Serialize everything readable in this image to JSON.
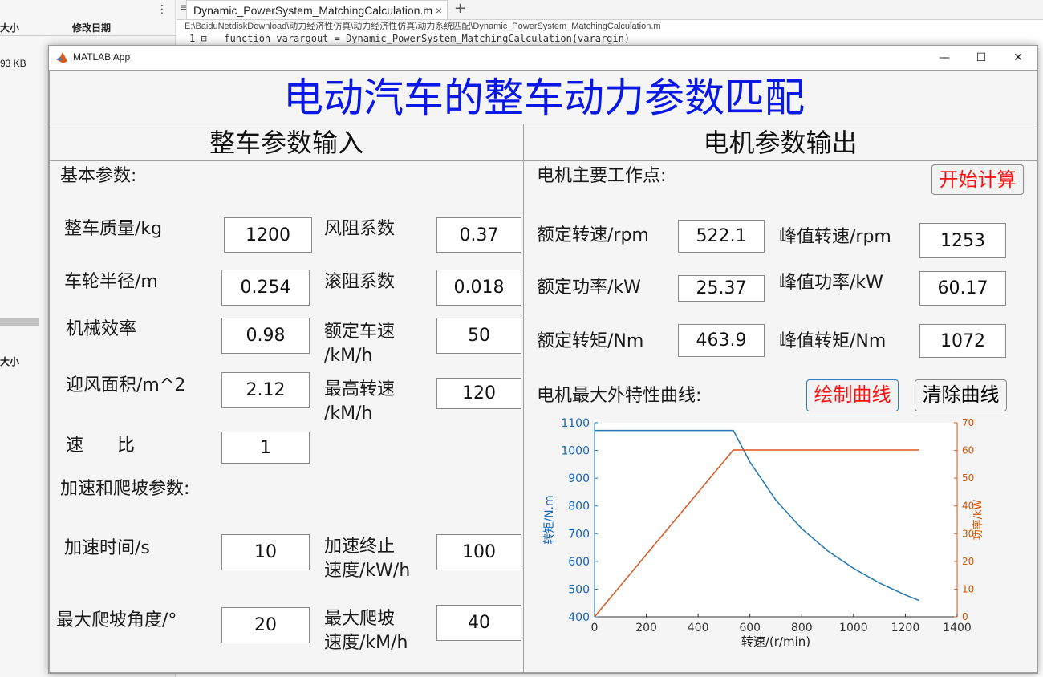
{
  "background": {
    "left_header_size": "大小",
    "left_header_date": "修改日期",
    "left_size_value": "93 KB",
    "left_section_size": "大小",
    "editor_tab": "Dynamic_PowerSystem_MatchingCalculation.m",
    "editor_tab_close": "×",
    "editor_new_tab": "+",
    "editor_path": "E:\\BaiduNetdiskDownload\\动力经济性仿真\\动力经济性仿真\\动力系统匹配\\Dynamic_PowerSystem_MatchingCalculation.m",
    "code_line": "1 ⊟   function varargout = Dynamic_PowerSystem_MatchingCalculation(varargin)"
  },
  "window": {
    "title": "MATLAB App",
    "minimize": "—",
    "maximize": "☐",
    "close": "✕"
  },
  "app": {
    "main_title": "电动汽车的整车动力参数匹配",
    "left_panel": {
      "title": "整车参数输入",
      "basic_params": "基本参数:",
      "accel_params": "加速和爬坡参数:",
      "fields": {
        "mass": {
          "label": "整车质量/kg",
          "value": "1200"
        },
        "drag": {
          "label": "风阻系数",
          "value": "0.37"
        },
        "wheel_radius": {
          "label": "车轮半径/m",
          "value": "0.254"
        },
        "rolling": {
          "label": "滚阻系数",
          "value": "0.018"
        },
        "mech_eff": {
          "label": "机械效率",
          "value": "0.98"
        },
        "rated_speed_l1": "额定车速",
        "rated_speed_l2": "/kM/h",
        "rated_speed_value": "50",
        "frontal_area": {
          "label": "迎风面积/m^2",
          "value": "2.12"
        },
        "max_speed_l1": "最高转速",
        "max_speed_l2": "/kM/h",
        "max_speed_value": "120",
        "ratio": {
          "label": "速      比",
          "value": "1"
        },
        "accel_time": {
          "label": "加速时间/s",
          "value": "10"
        },
        "accel_end_l1": "加速终止",
        "accel_end_l2": "速度/kW/h",
        "accel_end_value": "100",
        "max_grade": {
          "label": "最大爬坡角度/°",
          "value": "20"
        },
        "grade_speed_l1": "最大爬坡",
        "grade_speed_l2": "速度/kM/h",
        "grade_speed_value": "40"
      }
    },
    "right_panel": {
      "title": "电机参数输出",
      "main_points": "电机主要工作点:",
      "start_button": "开始计算",
      "outputs": {
        "rated_rpm": {
          "label": "额定转速/rpm",
          "value": "522.1"
        },
        "peak_rpm": {
          "label": "峰值转速/rpm",
          "value": "1253"
        },
        "rated_power": {
          "label": "额定功率/kW",
          "value": "25.37"
        },
        "peak_power": {
          "label": "峰值功率/kW",
          "value": "60.17"
        },
        "rated_torque": {
          "label": "额定转矩/Nm",
          "value": "463.9"
        },
        "peak_torque": {
          "label": "峰值转矩/Nm",
          "value": "1072"
        }
      },
      "curve_label": "电机最大外特性曲线:",
      "draw_button": "绘制曲线",
      "clear_button": "清除曲线"
    }
  },
  "chart_data": {
    "type": "line",
    "xlabel": "转速/(r/min)",
    "ylabel": "转矩/N.m",
    "ylabel_right": "功率/kW",
    "xlim": [
      0,
      1400
    ],
    "ylim": [
      400,
      1100
    ],
    "ylim_right": [
      0,
      70
    ],
    "xticks": [
      0,
      200,
      400,
      600,
      800,
      1000,
      1200,
      1400
    ],
    "yticks": [
      400,
      500,
      600,
      700,
      800,
      900,
      1000,
      1100
    ],
    "yticks_right": [
      0,
      10,
      20,
      30,
      40,
      50,
      60,
      70
    ],
    "grid": false,
    "colors": {
      "torque": "#1f77b4",
      "power": "#d95319"
    },
    "series": [
      {
        "axis": "left",
        "x": [
          0,
          536,
          600,
          700,
          800,
          900,
          1000,
          1100,
          1200,
          1253
        ],
        "y": [
          1072,
          1072,
          958,
          821,
          718,
          638,
          575,
          522,
          479,
          459
        ]
      },
      {
        "axis": "right",
        "x": [
          0,
          536,
          1253
        ],
        "y": [
          0,
          60.17,
          60.17
        ]
      }
    ]
  }
}
